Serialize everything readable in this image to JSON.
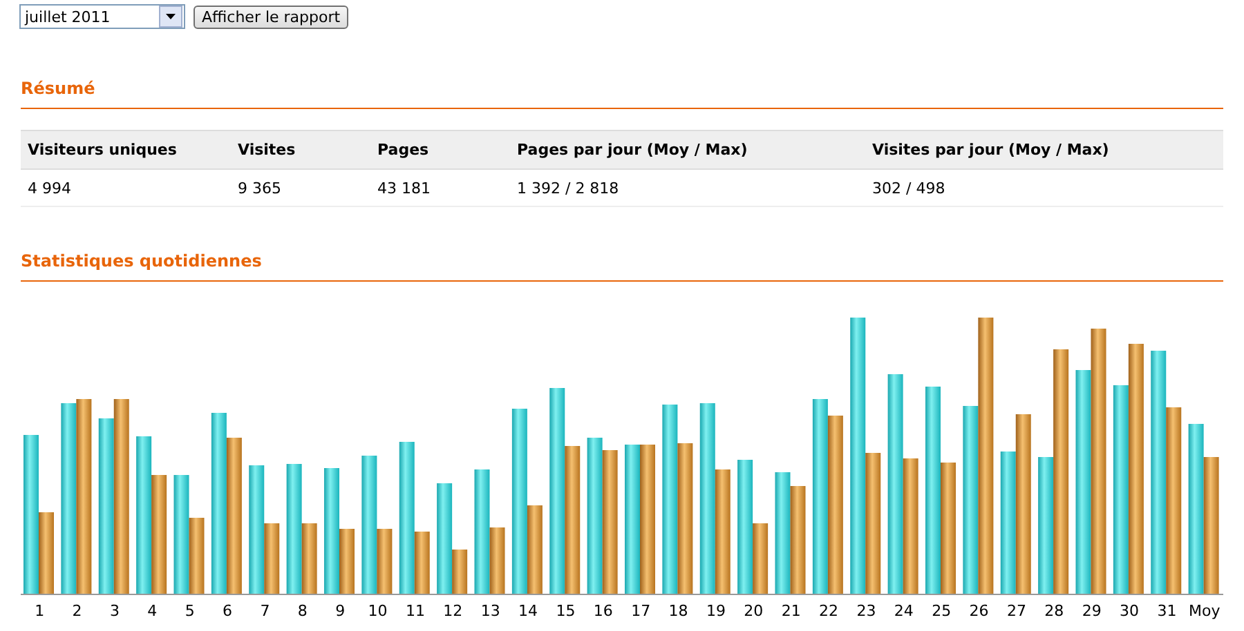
{
  "toolbar": {
    "month_select": {
      "value": "juillet 2011"
    },
    "button": "Afficher le rapport"
  },
  "summary": {
    "title": "Résumé",
    "table": {
      "columns": [
        "Visiteurs uniques",
        "Visites",
        "Pages",
        "Pages par jour (Moy / Max)",
        "Visites par jour (Moy / Max)"
      ],
      "rows": [
        [
          "4 994",
          "9 365",
          "43 181",
          "1 392 / 2 818",
          "302 / 498"
        ]
      ]
    }
  },
  "daily": {
    "title": "Statistiques quotidiennes",
    "x_labels": [
      "1",
      "2",
      "3",
      "4",
      "5",
      "6",
      "7",
      "8",
      "9",
      "10",
      "11",
      "12",
      "13",
      "14",
      "15",
      "16",
      "17",
      "18",
      "19",
      "20",
      "21",
      "22",
      "23",
      "24",
      "25",
      "26",
      "27",
      "28",
      "29",
      "30",
      "31",
      "Moy"
    ]
  }
}
